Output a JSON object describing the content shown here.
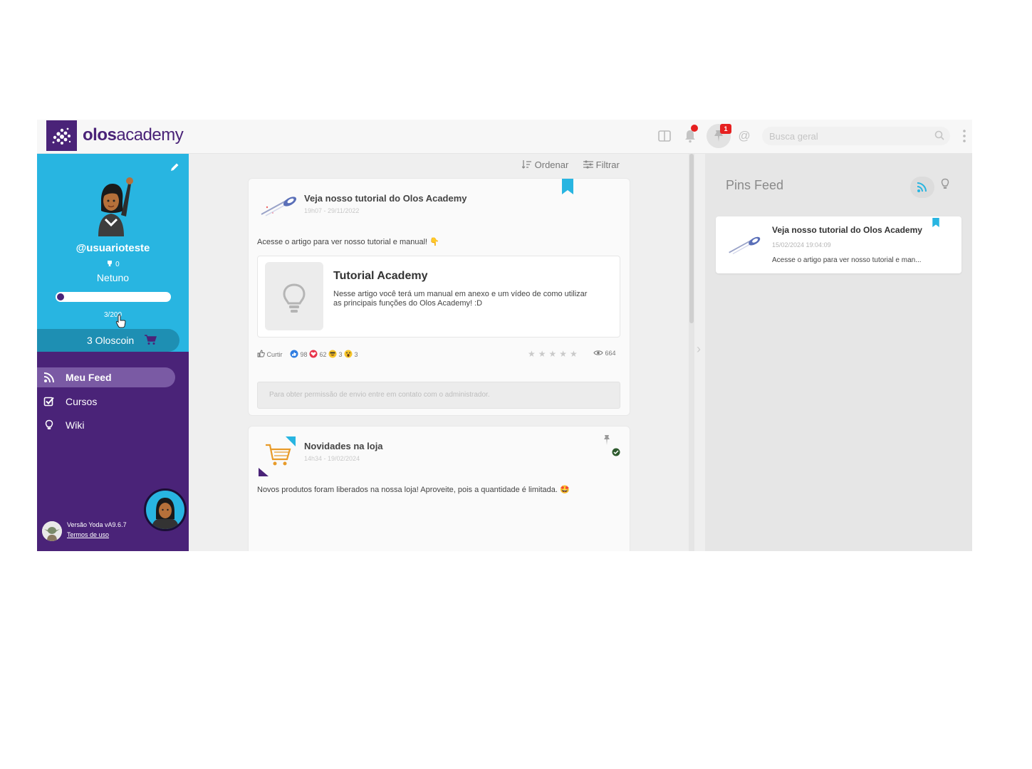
{
  "brand": {
    "name_bold": "olos",
    "name_light": "academy",
    "color": "#4a2378",
    "accent": "#28b5e1"
  },
  "header": {
    "notifications_dot": true,
    "pin_badge_count": "1",
    "search": {
      "placeholder": "Busca geral"
    }
  },
  "profile": {
    "username": "@usuarioteste",
    "trophies": "0",
    "level": "Netuno",
    "progress_fraction": 0.015,
    "progress_text": "3/200",
    "coins_label": "3  Oloscoin"
  },
  "nav": [
    {
      "label": "Meu Feed",
      "icon": "rss-icon",
      "active": true
    },
    {
      "label": "Cursos",
      "icon": "checkbox-icon",
      "active": false
    },
    {
      "label": "Wiki",
      "icon": "bulb-icon",
      "active": false
    }
  ],
  "footer": {
    "version": "Versão Yoda vA9.6.7",
    "terms": "Termos de uso"
  },
  "toolbar": {
    "sort_label": "Ordenar",
    "filter_label": "Filtrar"
  },
  "posts": [
    {
      "title": "Veja nosso tutorial do Olos Academy",
      "time": "19h07 - 29/11/2022",
      "body": "Acesse o artigo para ver nosso tutorial e manual! 👇",
      "embed": {
        "title": "Tutorial Academy",
        "description": "Nesse artigo você terá um manual em anexo e um vídeo de como utilizar as principais funções do Olos Academy! :D"
      },
      "reactions": {
        "like_label": "Curtir",
        "like": "98",
        "love": "62",
        "laugh": "3",
        "wow": "3"
      },
      "stars": "★★★★★",
      "views": "664",
      "comment_placeholder": "Para obter permissão de envio entre em contato com o administrador."
    },
    {
      "title": "Novidades na loja",
      "time": "14h34 - 19/02/2024",
      "body": "Novos produtos foram liberados na nossa loja! Aproveite, pois a quantidade é limitada. 🤩"
    }
  ],
  "pins_feed": {
    "title": "Pins Feed",
    "card": {
      "title": "Veja nosso tutorial do Olos Academy",
      "time": "15/02/2024 19:04:09",
      "text": "Acesse o artigo para ver nosso tutorial e man..."
    }
  }
}
